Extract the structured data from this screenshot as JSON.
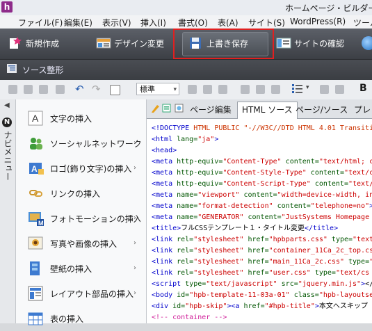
{
  "window": {
    "title": "ホームページ・ビルダー"
  },
  "menu": [
    "ファイル(F)",
    "編集(E)",
    "表示(V)",
    "挿入(I)",
    "書式(O)",
    "表(A)",
    "サイト(S)",
    "WordPress(R)",
    "ツール"
  ],
  "toolbar": {
    "new_label": "新規作成",
    "design_label": "デザイン変更",
    "save_label": "上書き保存",
    "site_label": "サイトの確認"
  },
  "source_bar": {
    "label": "ソース整形"
  },
  "editor_toolbar": {
    "style_value": "標準",
    "bold": "B"
  },
  "nav": {
    "title": "ナビメニュー",
    "items": [
      {
        "label": "文字の挿入",
        "icon": "text-a-icon",
        "chevron": false
      },
      {
        "label": "ソーシャルネットワークの挿入",
        "icon": "social-people-icon",
        "chevron": true
      },
      {
        "label": "ロゴ(飾り文字)の挿入",
        "icon": "logo-icon",
        "chevron": true
      },
      {
        "label": "リンクの挿入",
        "icon": "link-icon",
        "chevron": false
      },
      {
        "label": "フォトモーションの挿入",
        "icon": "photo-motion-icon",
        "chevron": true
      },
      {
        "label": "写真や画像の挿入",
        "icon": "image-icon",
        "chevron": true
      },
      {
        "label": "壁紙の挿入",
        "icon": "wallpaper-icon",
        "chevron": true
      },
      {
        "label": "レイアウト部品の挿入",
        "icon": "layout-parts-icon",
        "chevron": true
      },
      {
        "label": "表の挿入",
        "icon": "table-icon",
        "chevron": false
      }
    ]
  },
  "tabs": [
    "ページ編集",
    "HTML ソース",
    "ページ/ソース",
    "プレビ"
  ],
  "code_lines": [
    [
      [
        "tg",
        "<!DOCTYPE "
      ],
      [
        "dt",
        "HTML PUBLIC \"-//W3C//DTD HTML 4.01 Transiti"
      ]
    ],
    [
      [
        "tg",
        "<html "
      ],
      [
        "at",
        "lang="
      ],
      [
        "st",
        "\"ja\""
      ],
      [
        "tg",
        ">"
      ]
    ],
    [
      [
        "tg",
        "<head>"
      ]
    ],
    [
      [
        "tg",
        "<meta "
      ],
      [
        "at",
        "http-equiv="
      ],
      [
        "st",
        "\"Content-Type\" "
      ],
      [
        "at",
        "content="
      ],
      [
        "st",
        "\"text/html; c"
      ]
    ],
    [
      [
        "tg",
        "<meta "
      ],
      [
        "at",
        "http-equiv="
      ],
      [
        "st",
        "\"Content-Style-Type\" "
      ],
      [
        "at",
        "content="
      ],
      [
        "st",
        "\"text/c"
      ]
    ],
    [
      [
        "tg",
        "<meta "
      ],
      [
        "at",
        "http-equiv="
      ],
      [
        "st",
        "\"Content-Script-Type\" "
      ],
      [
        "at",
        "content="
      ],
      [
        "st",
        "\"text/"
      ]
    ],
    [
      [
        "tg",
        "<meta "
      ],
      [
        "at",
        "name="
      ],
      [
        "st",
        "\"viewport\" "
      ],
      [
        "at",
        "content="
      ],
      [
        "st",
        "\"width=device-width, in"
      ]
    ],
    [
      [
        "tg",
        "<meta "
      ],
      [
        "at",
        "name="
      ],
      [
        "st",
        "\"format-detection\" "
      ],
      [
        "at",
        "content="
      ],
      [
        "st",
        "\"telephone=no\""
      ],
      [
        "tg",
        ">"
      ]
    ],
    [
      [
        "tg",
        "<meta "
      ],
      [
        "at",
        "name="
      ],
      [
        "st",
        "\"GENERATOR\" "
      ],
      [
        "at",
        "content="
      ],
      [
        "st",
        "\"JustSystems Homepage "
      ]
    ],
    [
      [
        "tg",
        "<title>"
      ],
      [
        "tx",
        "フルCSSテンプレート１・タイトル変更"
      ],
      [
        "tg",
        "</title>"
      ]
    ],
    [
      [
        "tg",
        "<link "
      ],
      [
        "at",
        "rel="
      ],
      [
        "st",
        "\"stylesheet\" "
      ],
      [
        "at",
        "href="
      ],
      [
        "st",
        "\"hpbparts.css\" "
      ],
      [
        "at",
        "type="
      ],
      [
        "st",
        "\"text"
      ]
    ],
    [
      [
        "tg",
        "<link "
      ],
      [
        "at",
        "rel="
      ],
      [
        "st",
        "\"stylesheet\" "
      ],
      [
        "at",
        "href="
      ],
      [
        "st",
        "\"container_11Ca_2c_top.cs"
      ]
    ],
    [
      [
        "tg",
        "<link "
      ],
      [
        "at",
        "rel="
      ],
      [
        "st",
        "\"stylesheet\" "
      ],
      [
        "at",
        "href="
      ],
      [
        "st",
        "\"main_11Ca_2c.css\" "
      ],
      [
        "at",
        "type="
      ],
      [
        "st",
        "\""
      ]
    ],
    [
      [
        "tg",
        "<link "
      ],
      [
        "at",
        "rel="
      ],
      [
        "st",
        "\"stylesheet\" "
      ],
      [
        "at",
        "href="
      ],
      [
        "st",
        "\"user.css\" "
      ],
      [
        "at",
        "type="
      ],
      [
        "st",
        "\"text/cs"
      ]
    ],
    [
      [
        "tg",
        "<script "
      ],
      [
        "at",
        "type="
      ],
      [
        "st",
        "\"text/javascript\" "
      ],
      [
        "at",
        "src="
      ],
      [
        "st",
        "\"jquery.min.js\""
      ],
      [
        "tg",
        ">"
      ],
      [
        "tx",
        "</"
      ]
    ],
    [
      [
        "tg",
        "<body "
      ],
      [
        "at",
        "id="
      ],
      [
        "st",
        "\"hpb-template-11-03a-01\" "
      ],
      [
        "at",
        "class="
      ],
      [
        "st",
        "\"hpb-layoutse"
      ]
    ],
    [
      [
        "tg",
        "<div "
      ],
      [
        "at",
        "id="
      ],
      [
        "st",
        "\"hpb-skip\""
      ],
      [
        "tg",
        "><a "
      ],
      [
        "at",
        "href="
      ],
      [
        "st",
        "\"#hpb-title\""
      ],
      [
        "tg",
        ">"
      ],
      [
        "tx",
        "本文へスキップ"
      ]
    ],
    [
      [
        "cm",
        "<!-- container -->"
      ]
    ]
  ]
}
